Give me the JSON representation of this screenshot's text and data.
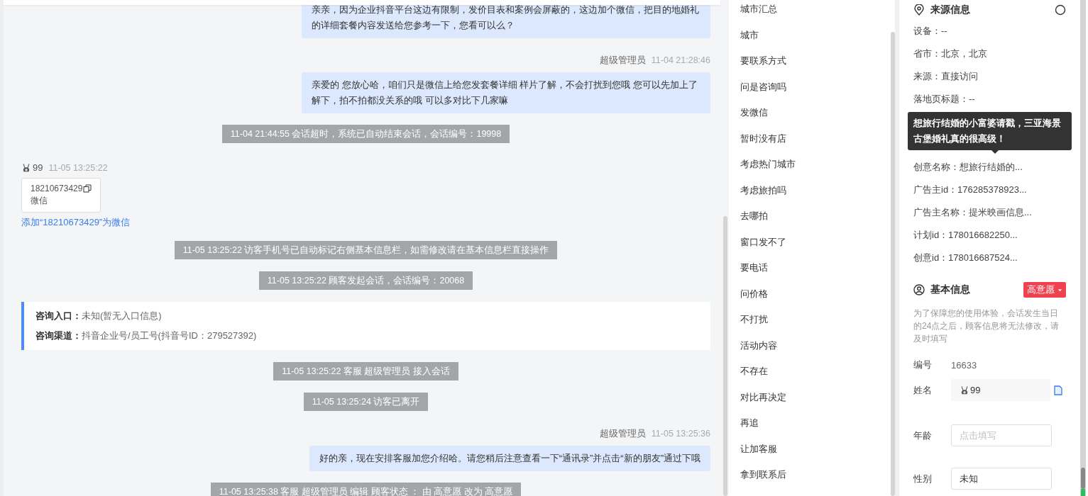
{
  "chat": {
    "messages": [
      {
        "kind": "agent",
        "text": "亲亲，因为企业抖音平台这边有限制，发价目表和案例会屏蔽的，这边加个微信，把目的地婚礼的详细套餐内容发送给您参考一下，您看可以么？"
      },
      {
        "kind": "agent",
        "sender": "超级管理员",
        "time": "11-04 21:28:46",
        "text": "亲爱的 您放心哈，咱们只是微信上给您发套餐详细 样片了解，不会打扰到您哦 您可以先加上了解下，拍不拍都没关系的哦 可以多对比下几家嘛"
      },
      {
        "kind": "system",
        "text": "11-04 21:44:55 会话超时，系统已自动结束会话，会话编号：19998"
      },
      {
        "kind": "visitor",
        "name": "99",
        "time": "11-05 13:25:22",
        "card_number": "18210673429",
        "card_label": "微信",
        "link": "添加“18210673429”为微信"
      },
      {
        "kind": "system",
        "text": "11-05 13:25:22 访客手机号已自动标记右侧基本信息栏，如需修改请在基本信息栏直接操作"
      },
      {
        "kind": "system",
        "text": "11-05 13:25:22 顾客发起会话，会话编号：20068"
      },
      {
        "kind": "info",
        "rows": [
          {
            "label": "咨询入口：",
            "value": "未知(暂无入口信息)"
          },
          {
            "label": "咨询渠道：",
            "value": "抖音企业号/员工号(抖音号ID：279527392)"
          }
        ]
      },
      {
        "kind": "system",
        "text": "11-05 13:25:22 客服 超级管理员 接入会话"
      },
      {
        "kind": "system",
        "text": "11-05 13:25:24 访客已离开"
      },
      {
        "kind": "agent",
        "sender": "超级管理员",
        "time": "11-05 13:25:36",
        "text": "好的亲，现在安排客服加您介绍哈。请您稍后注意查看一下“通讯录”并点击“新的朋友”通过下哦"
      },
      {
        "kind": "system",
        "text": "11-05 13:25:38 客服 超级管理员 编辑 顾客状态 ： 由 高意愿 改为 高意愿"
      }
    ]
  },
  "quick_replies": [
    "城市汇总",
    "城市",
    "要联系方式",
    "问是咨询吗",
    "发微信",
    "暂时没有店",
    "考虑热门城市",
    "考虑旅拍吗",
    "去哪拍",
    "窗口发不了",
    "要电话",
    "问价格",
    "不打扰",
    "活动内容",
    "不存在",
    "对比再决定",
    "再追",
    "让加客服",
    "拿到联系后"
  ],
  "source_info": {
    "title": "来源信息",
    "rows_top": [
      {
        "text": "设备：--"
      },
      {
        "text": "省市：北京，北京"
      },
      {
        "text": "来源：直接访问"
      },
      {
        "text": "落地页标题：--"
      }
    ],
    "rows_bottom": [
      {
        "text": "创意名称：想旅行结婚的..."
      },
      {
        "text": "广告主id：176285378923..."
      },
      {
        "text": "广告主名称：提米映画信息..."
      },
      {
        "text": "计划id：178016682250..."
      },
      {
        "text": "创意id：178016687524..."
      }
    ],
    "tooltip": "想旅行结婚的小富婆请戳，三亚海景古堡婚礼真的很高级！"
  },
  "basic_info": {
    "title": "基本信息",
    "intent": "高意愿",
    "note": "为了保障您的使用体验，会话发生当日的24点之后，顾客信息将无法修改，请及时填写",
    "fields": [
      {
        "kind": "text",
        "label": "编号",
        "value": "16633"
      },
      {
        "kind": "name",
        "label": "姓名",
        "value": "99"
      },
      {
        "kind": "input",
        "label": "年龄",
        "placeholder": "点击填写"
      },
      {
        "kind": "input",
        "label": "性别",
        "value": "未知"
      }
    ]
  }
}
